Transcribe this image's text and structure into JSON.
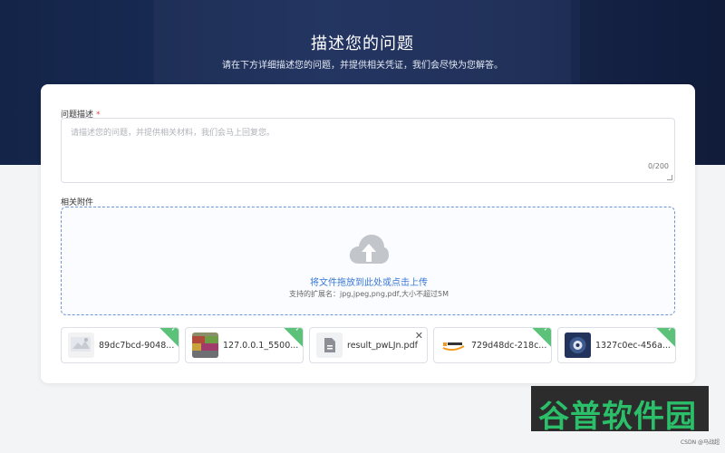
{
  "header": {
    "title": "描述您的问题",
    "subtitle": "请在下方详细描述您的问题，并提供相关凭证，我们会尽快为您解答。"
  },
  "form": {
    "description": {
      "label": "问题描述",
      "required_mark": "*",
      "placeholder": "请描述您的问题，并提供相关材料，我们会马上回复您。",
      "counter": "0/200"
    },
    "attachments": {
      "label": "相关附件",
      "upload_text": "将文件拖放到此处或点击上传",
      "hint": "支持的扩展名：jpg,jpeg,png,pdf,大小不超过5M",
      "files": [
        {
          "name": "89dc7bcd-9048...",
          "status": "success",
          "icon": "image-thumb"
        },
        {
          "name": "127.0.0.1_5500...",
          "status": "success",
          "icon": "image-thumb"
        },
        {
          "name": "result_pwLJn.pdf",
          "status": "removable",
          "icon": "file-icon"
        },
        {
          "name": "729d48dc-218c...",
          "status": "success",
          "icon": "image-thumb"
        },
        {
          "name": "1327c0ec-456a...",
          "status": "success",
          "icon": "image-thumb"
        }
      ]
    }
  },
  "overlay": {
    "watermark": "谷普软件园",
    "credit": "CSDN @马战超"
  },
  "colors": {
    "accent": "#3a78d6",
    "success": "#5cc27a",
    "required": "#e14b4b",
    "hero": "#1c2f5c"
  }
}
